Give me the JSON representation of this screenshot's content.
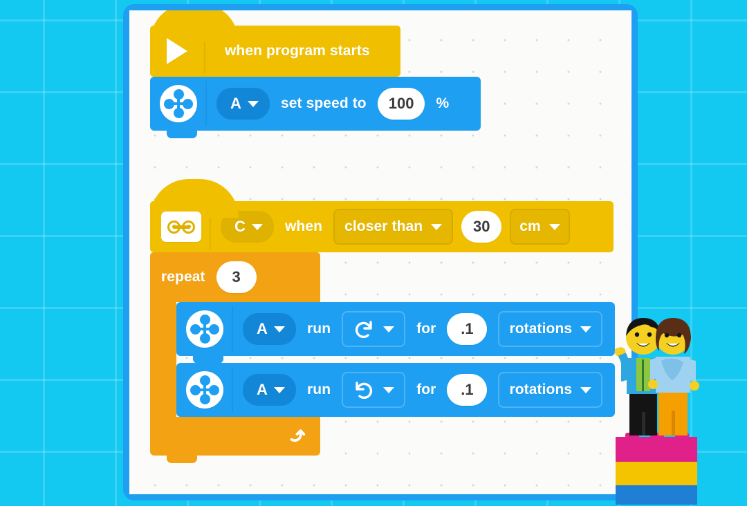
{
  "app": {
    "title": "LEGO Block Programming Canvas",
    "background_color": "#13c9f2",
    "canvas_border_color": "#1e9ff2",
    "canvas_color": "#fbfbf9"
  },
  "palette": {
    "event_yellow": "#f0c000",
    "control_orange": "#f2a212",
    "motor_blue": "#1e9ff2",
    "motor_blue_dark": "#1287d8",
    "value_white": "#ffffff"
  },
  "scripts": [
    {
      "id": "script-one",
      "blocks": [
        {
          "type": "hat",
          "category": "event",
          "icon": "play-icon",
          "label": "when program starts"
        },
        {
          "type": "stack",
          "category": "motor",
          "icon": "motor-hub-icon",
          "port": "A",
          "label": "set speed to",
          "value": "100",
          "unit": "%"
        }
      ]
    },
    {
      "id": "script-two",
      "blocks": [
        {
          "type": "hat",
          "category": "sensor",
          "icon": "distance-sensor-icon",
          "port": "C",
          "label": "when",
          "comparison": "closer than",
          "value": "30",
          "unit": "cm"
        },
        {
          "type": "c-block",
          "category": "control",
          "label": "repeat",
          "value": "3",
          "loop_icon": "loop-arrow-icon",
          "children": [
            {
              "type": "stack",
              "category": "motor",
              "icon": "motor-hub-icon",
              "port": "A",
              "label": "run",
              "direction": "clockwise-icon",
              "for_label": "for",
              "value": ".1",
              "unit": "rotations"
            },
            {
              "type": "stack",
              "category": "motor",
              "icon": "motor-hub-icon",
              "port": "A",
              "label": "run",
              "direction": "counter-clockwise-icon",
              "for_label": "for",
              "value": ".1",
              "unit": "rotations"
            }
          ]
        }
      ]
    }
  ],
  "block_one": {
    "hat_label": "when program starts",
    "port": "A",
    "speed_label": "set speed to",
    "speed_value": "100",
    "percent": "%"
  },
  "block_two": {
    "port": "C",
    "when_label": "when",
    "comparison": "closer than",
    "distance_value": "30",
    "distance_unit": "cm"
  },
  "repeat_block": {
    "label": "repeat",
    "count": "3"
  },
  "motor_run_one": {
    "port": "A",
    "run_label": "run",
    "for_label": "for",
    "amount": ".1",
    "unit": "rotations"
  },
  "motor_run_two": {
    "port": "A",
    "run_label": "run",
    "for_label": "for",
    "amount": ".1",
    "unit": "rotations"
  },
  "decoration": {
    "minifigures": "two-lego-minifigures-on-brick-stack",
    "brick_colors": [
      "#e0218a",
      "#f5c400",
      "#1e7fd4"
    ]
  }
}
